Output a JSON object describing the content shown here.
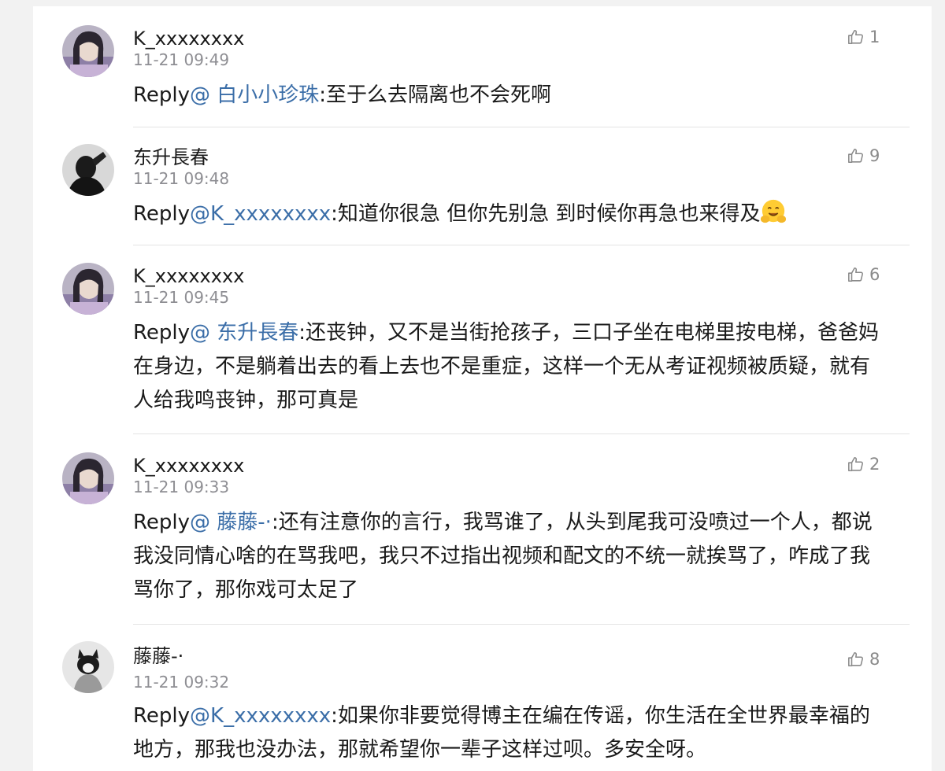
{
  "comments": [
    {
      "author": "K_xxxxxxxx",
      "time": "11-21 09:49",
      "likes": "1",
      "reply_prefix": "Reply",
      "mention": "@ 白小小珍珠",
      "text": ":至于么去隔离也不会死啊",
      "avatar": "girl-photo"
    },
    {
      "author": "东升長春",
      "time": "11-21 09:48",
      "likes": "9",
      "reply_prefix": "Reply",
      "mention": "@K_xxxxxxxx",
      "text": ":知道你很急 但你先别急 到时候你再急也来得及",
      "emoji": "hugging-face",
      "avatar": "dark-silhouette"
    },
    {
      "author": "K_xxxxxxxx",
      "time": "11-21 09:45",
      "likes": "6",
      "reply_prefix": "Reply",
      "mention": "@ 东升長春",
      "text": ":还丧钟，又不是当街抢孩子，三口子坐在电梯里按电梯，爸爸妈在身边，不是躺着出去的看上去也不是重症，这样一个无从考证视频被质疑，就有人给我鸣丧钟，那可真是",
      "avatar": "girl-photo"
    },
    {
      "author": "K_xxxxxxxx",
      "time": "11-21 09:33",
      "likes": "2",
      "reply_prefix": "Reply",
      "mention": "@ 藤藤-·",
      "text": ":还有注意你的言行，我骂谁了，从头到尾我可没喷过一个人，都说我没同情心啥的在骂我吧，我只不过指出视频和配文的不统一就挨骂了，咋成了我骂你了，那你戏可太足了",
      "avatar": "girl-photo"
    },
    {
      "author": "藤藤-·",
      "time": "11-21 09:32",
      "likes": "8",
      "reply_prefix": "Reply",
      "mention": "@K_xxxxxxxx",
      "text": ":如果你非要觉得博主在编在传谣，你生活在全世界最幸福的地方，那我也没办法，那就希望你一辈子这样过呗。多安全呀。",
      "avatar": "cat-photo"
    }
  ],
  "icons": {
    "like": "thumbs-up-icon"
  },
  "colors": {
    "mention": "#3b6ea8",
    "meta": "#8e8e93",
    "text": "#1a1a1a"
  }
}
